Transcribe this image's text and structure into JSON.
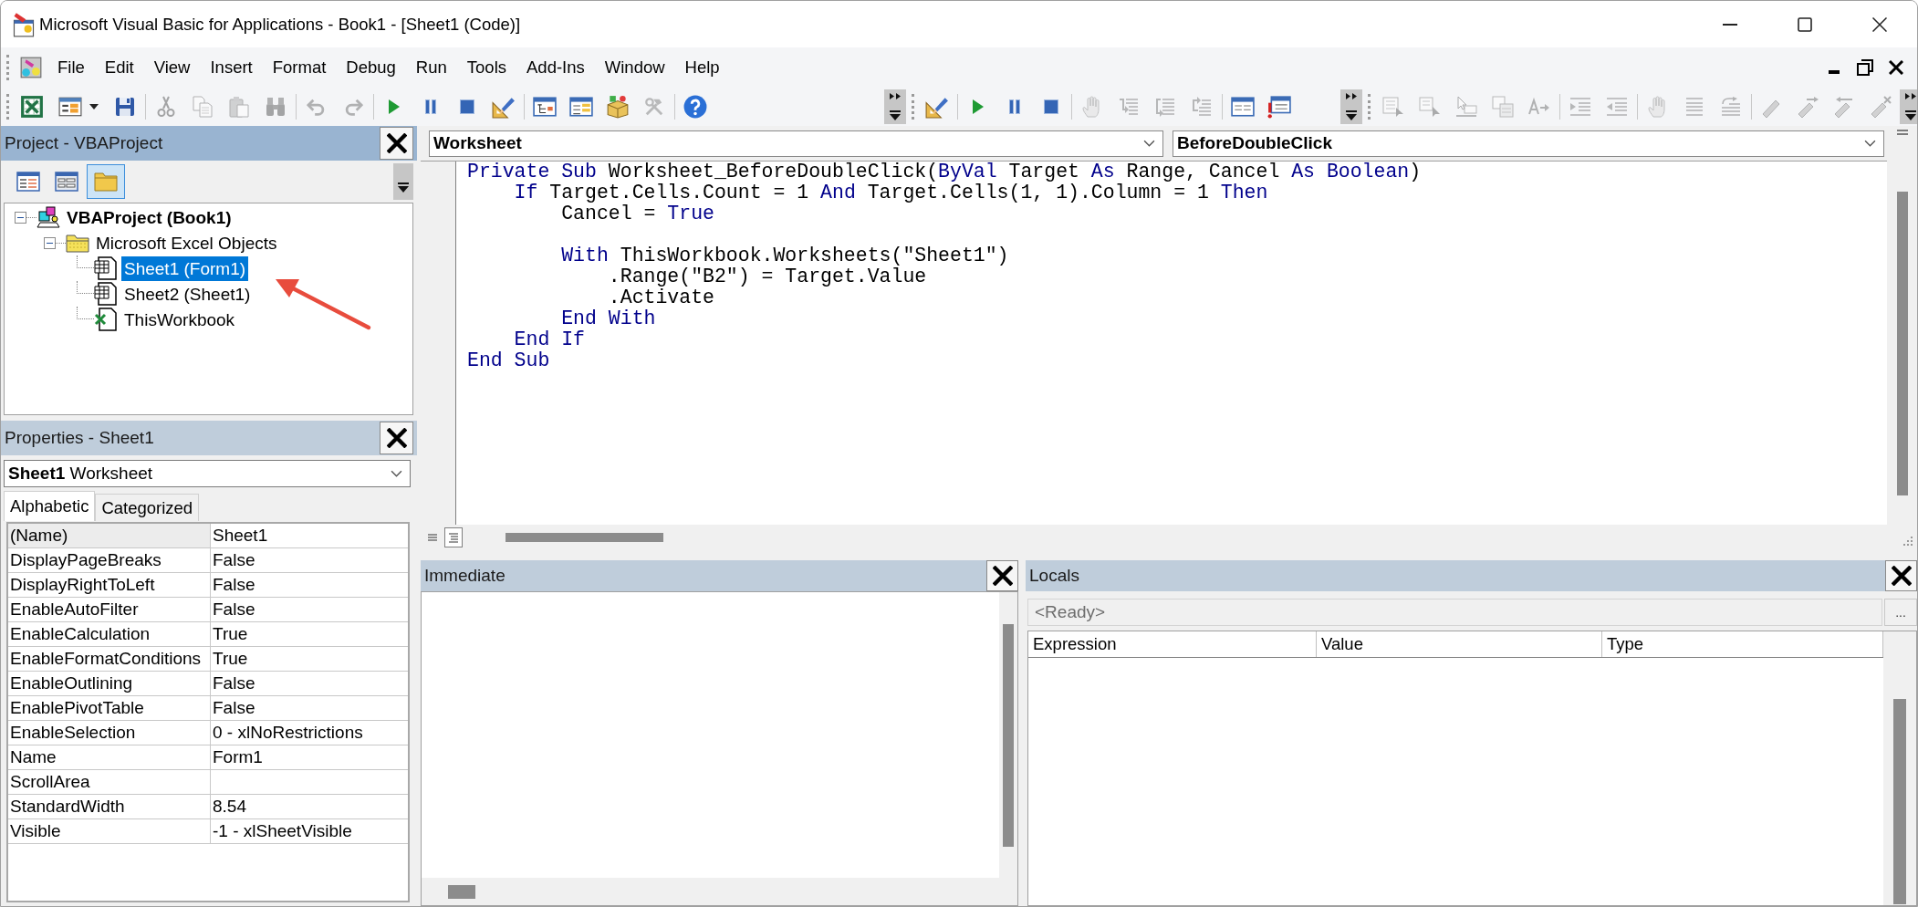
{
  "window": {
    "title": "Microsoft Visual Basic for Applications - Book1 - [Sheet1 (Code)]"
  },
  "menu": [
    "File",
    "Edit",
    "View",
    "Insert",
    "Format",
    "Debug",
    "Run",
    "Tools",
    "Add-Ins",
    "Window",
    "Help"
  ],
  "toolbars": [
    {
      "groups": [
        [
          {
            "disabled": false
          },
          {
            "disabled": false
          },
          {
            "disabled": false
          }
        ],
        [
          {
            "disabled": true
          },
          {
            "disabled": true
          },
          {
            "disabled": true
          },
          {
            "disabled": true
          }
        ],
        [
          {
            "disabled": true
          },
          {
            "disabled": true
          }
        ],
        [
          {
            "disabled": false
          },
          {
            "disabled": false
          },
          {
            "disabled": false
          },
          {
            "disabled": false
          }
        ],
        [
          {
            "disabled": false
          },
          {
            "disabled": false
          },
          {
            "disabled": false
          },
          {
            "disabled": true
          }
        ],
        [
          {
            "disabled": false
          }
        ]
      ]
    },
    {
      "groups": [
        [
          {
            "disabled": false
          }
        ],
        [
          {
            "disabled": false
          },
          {
            "disabled": false
          },
          {
            "disabled": false
          }
        ],
        [
          {
            "disabled": true
          },
          {
            "disabled": true
          },
          {
            "disabled": true
          },
          {
            "disabled": true
          }
        ],
        [
          {
            "disabled": false
          },
          {
            "disabled": false
          }
        ]
      ]
    },
    {
      "groups": [
        [
          {
            "disabled": true
          },
          {
            "disabled": true
          },
          {
            "disabled": true
          },
          {
            "disabled": true
          },
          {
            "disabled": true
          }
        ],
        [
          {
            "disabled": true
          },
          {
            "disabled": true
          }
        ],
        [
          {
            "disabled": true
          },
          {
            "disabled": true
          },
          {
            "disabled": true
          }
        ],
        [
          {
            "disabled": true
          },
          {
            "disabled": true
          },
          {
            "disabled": true
          },
          {
            "disabled": true
          }
        ]
      ]
    }
  ],
  "project_explorer": {
    "title": "Project - VBAProject",
    "active": true,
    "buttons": [
      {
        "pressed": false
      },
      {
        "pressed": false
      },
      {
        "pressed": true
      }
    ],
    "tree": [
      {
        "label": "VBAProject (Book1)",
        "kind": "project",
        "expanded": true,
        "selected": false,
        "children": [
          {
            "label": "Microsoft Excel Objects",
            "kind": "folder",
            "expanded": true,
            "selected": false,
            "children": [
              {
                "label": "Sheet1 (Form1)",
                "kind": "sheet",
                "selected": true
              },
              {
                "label": "Sheet2 (Sheet1)",
                "kind": "sheet",
                "selected": false
              },
              {
                "label": "ThisWorkbook",
                "kind": "workbook",
                "selected": false
              }
            ]
          }
        ]
      }
    ]
  },
  "properties": {
    "title": "Properties - Sheet1",
    "active": false,
    "object": "**Sheet1** Worksheet",
    "tabs": [
      {
        "label": "Alphabetic",
        "selected": true
      },
      {
        "label": "Categorized",
        "selected": false
      }
    ],
    "rows": [
      {
        "name": "(Name)",
        "value": "Sheet1",
        "selected": true
      },
      {
        "name": "DisplayPageBreaks",
        "value": "False",
        "selected": false
      },
      {
        "name": "DisplayRightToLeft",
        "value": "False",
        "selected": false
      },
      {
        "name": "EnableAutoFilter",
        "value": "False",
        "selected": false
      },
      {
        "name": "EnableCalculation",
        "value": "True",
        "selected": false
      },
      {
        "name": "EnableFormatConditions",
        "value": "True",
        "selected": false
      },
      {
        "name": "EnableOutlining",
        "value": "False",
        "selected": false
      },
      {
        "name": "EnablePivotTable",
        "value": "False",
        "selected": false
      },
      {
        "name": "EnableSelection",
        "value": "0 - xlNoRestrictions",
        "selected": false
      },
      {
        "name": "Name",
        "value": "Form1",
        "selected": false
      },
      {
        "name": "ScrollArea",
        "selected": false
      },
      {
        "name": "StandardWidth",
        "value": "8.54",
        "selected": false
      },
      {
        "name": "Visible",
        "value": "-1 - xlSheetVisible",
        "selected": false
      }
    ]
  },
  "code_window": {
    "object": "Worksheet",
    "procedure": "BeforeDoubleClick",
    "blocks": [
      {
        "lines": [
          {
            "tokens": [
              {
                "text": "Private Sub",
                "keyword": true
              },
              {
                "text": " Worksheet_BeforeDoubleClick(",
                "keyword": false
              },
              {
                "text": "ByVal",
                "keyword": true
              },
              {
                "text": " Target ",
                "keyword": false
              },
              {
                "text": "As",
                "keyword": true
              },
              {
                "text": " Range, Cancel ",
                "keyword": false
              },
              {
                "text": "As Boolean",
                "keyword": true
              },
              {
                "text": ")",
                "keyword": false
              }
            ]
          },
          {
            "tokens": [
              {
                "text": "    If",
                "keyword": true
              },
              {
                "text": " Target.Cells.Count = 1 ",
                "keyword": false
              },
              {
                "text": "And",
                "keyword": true
              },
              {
                "text": " Target.Cells(1, 1).Column = 1 ",
                "keyword": false
              },
              {
                "text": "Then",
                "keyword": true
              }
            ]
          },
          {
            "tokens": [
              {
                "text": "        Cancel = ",
                "keyword": false
              },
              {
                "text": "True",
                "keyword": true
              }
            ]
          }
        ]
      },
      {
        "lines": [
          {
            "tokens": [
              {
                "text": "        With",
                "keyword": true
              },
              {
                "text": " ThisWorkbook.Worksheets(\"Sheet1\")",
                "keyword": false
              }
            ]
          },
          {
            "tokens": [
              {
                "text": "            .Range(\"B2\") = Target.Value",
                "keyword": false
              }
            ]
          },
          {
            "tokens": [
              {
                "text": "            .Activate",
                "keyword": false
              }
            ]
          },
          {
            "tokens": [
              {
                "text": "        End With",
                "keyword": true
              }
            ]
          },
          {
            "tokens": [
              {
                "text": "    End If",
                "keyword": true
              }
            ]
          },
          {
            "tokens": [
              {
                "text": "End Sub",
                "keyword": true
              }
            ]
          }
        ]
      }
    ],
    "view_buttons": [
      {
        "selected": false
      },
      {
        "selected": true
      }
    ]
  },
  "immediate": {
    "title": "Immediate",
    "active": false
  },
  "locals": {
    "title": "Locals",
    "active": false,
    "status": "<Ready>",
    "more_button": "...",
    "columns": [
      "Expression",
      "Value",
      "Type"
    ]
  }
}
